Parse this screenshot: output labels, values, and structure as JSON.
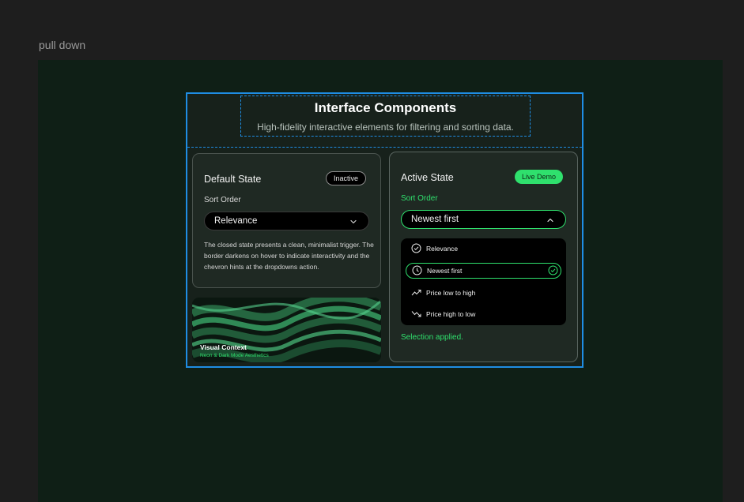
{
  "canvas": {
    "label": "pull down"
  },
  "header": {
    "title": "Interface Components",
    "subtitle": "High-fidelity interactive elements for filtering and sorting data."
  },
  "default_card": {
    "title": "Default State",
    "badge": "Inactive",
    "sort_label": "Sort Order",
    "selected_value": "Relevance",
    "description": "The closed state presents a clean, minimalist trigger. The border darkens on hover to indicate interactivity and the chevron hints at the dropdowns action."
  },
  "image_card": {
    "title": "Visual Context",
    "subtitle": "Neon & Dark Mode Aesthetics"
  },
  "active_card": {
    "title": "Active State",
    "badge": "Live Demo",
    "sort_label": "Sort Order",
    "selected_value": "Newest first",
    "options": [
      {
        "label": "Relevance",
        "icon": "check-circle-icon",
        "selected": false
      },
      {
        "label": "Newest first",
        "icon": "clock-icon",
        "selected": true
      },
      {
        "label": "Price low to high",
        "icon": "trending-up-icon",
        "selected": false
      },
      {
        "label": "Price high to low",
        "icon": "trending-down-icon",
        "selected": false
      }
    ],
    "status": "Selection applied."
  },
  "colors": {
    "accent": "#2fe06d",
    "selection_outline": "#1f8de3",
    "frame_background": "#0f1f16",
    "card_background": "#1f2923"
  }
}
